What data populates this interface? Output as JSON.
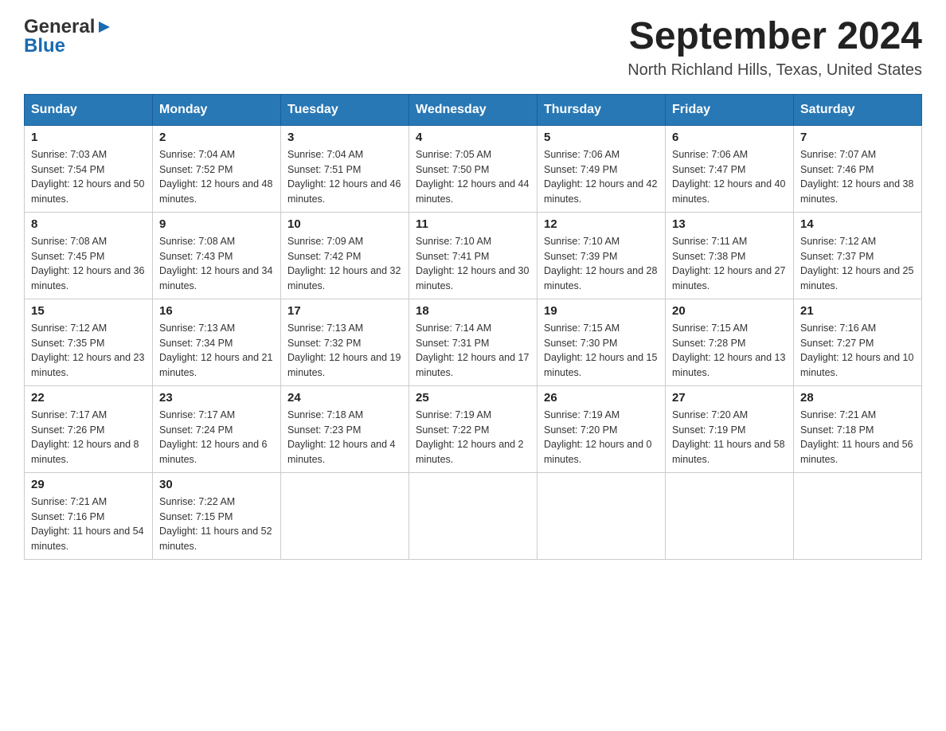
{
  "header": {
    "logo_general": "General",
    "logo_blue": "Blue",
    "month_title": "September 2024",
    "location": "North Richland Hills, Texas, United States"
  },
  "days_of_week": [
    "Sunday",
    "Monday",
    "Tuesday",
    "Wednesday",
    "Thursday",
    "Friday",
    "Saturday"
  ],
  "weeks": [
    [
      {
        "day": "1",
        "sunrise": "Sunrise: 7:03 AM",
        "sunset": "Sunset: 7:54 PM",
        "daylight": "Daylight: 12 hours and 50 minutes."
      },
      {
        "day": "2",
        "sunrise": "Sunrise: 7:04 AM",
        "sunset": "Sunset: 7:52 PM",
        "daylight": "Daylight: 12 hours and 48 minutes."
      },
      {
        "day": "3",
        "sunrise": "Sunrise: 7:04 AM",
        "sunset": "Sunset: 7:51 PM",
        "daylight": "Daylight: 12 hours and 46 minutes."
      },
      {
        "day": "4",
        "sunrise": "Sunrise: 7:05 AM",
        "sunset": "Sunset: 7:50 PM",
        "daylight": "Daylight: 12 hours and 44 minutes."
      },
      {
        "day": "5",
        "sunrise": "Sunrise: 7:06 AM",
        "sunset": "Sunset: 7:49 PM",
        "daylight": "Daylight: 12 hours and 42 minutes."
      },
      {
        "day": "6",
        "sunrise": "Sunrise: 7:06 AM",
        "sunset": "Sunset: 7:47 PM",
        "daylight": "Daylight: 12 hours and 40 minutes."
      },
      {
        "day": "7",
        "sunrise": "Sunrise: 7:07 AM",
        "sunset": "Sunset: 7:46 PM",
        "daylight": "Daylight: 12 hours and 38 minutes."
      }
    ],
    [
      {
        "day": "8",
        "sunrise": "Sunrise: 7:08 AM",
        "sunset": "Sunset: 7:45 PM",
        "daylight": "Daylight: 12 hours and 36 minutes."
      },
      {
        "day": "9",
        "sunrise": "Sunrise: 7:08 AM",
        "sunset": "Sunset: 7:43 PM",
        "daylight": "Daylight: 12 hours and 34 minutes."
      },
      {
        "day": "10",
        "sunrise": "Sunrise: 7:09 AM",
        "sunset": "Sunset: 7:42 PM",
        "daylight": "Daylight: 12 hours and 32 minutes."
      },
      {
        "day": "11",
        "sunrise": "Sunrise: 7:10 AM",
        "sunset": "Sunset: 7:41 PM",
        "daylight": "Daylight: 12 hours and 30 minutes."
      },
      {
        "day": "12",
        "sunrise": "Sunrise: 7:10 AM",
        "sunset": "Sunset: 7:39 PM",
        "daylight": "Daylight: 12 hours and 28 minutes."
      },
      {
        "day": "13",
        "sunrise": "Sunrise: 7:11 AM",
        "sunset": "Sunset: 7:38 PM",
        "daylight": "Daylight: 12 hours and 27 minutes."
      },
      {
        "day": "14",
        "sunrise": "Sunrise: 7:12 AM",
        "sunset": "Sunset: 7:37 PM",
        "daylight": "Daylight: 12 hours and 25 minutes."
      }
    ],
    [
      {
        "day": "15",
        "sunrise": "Sunrise: 7:12 AM",
        "sunset": "Sunset: 7:35 PM",
        "daylight": "Daylight: 12 hours and 23 minutes."
      },
      {
        "day": "16",
        "sunrise": "Sunrise: 7:13 AM",
        "sunset": "Sunset: 7:34 PM",
        "daylight": "Daylight: 12 hours and 21 minutes."
      },
      {
        "day": "17",
        "sunrise": "Sunrise: 7:13 AM",
        "sunset": "Sunset: 7:32 PM",
        "daylight": "Daylight: 12 hours and 19 minutes."
      },
      {
        "day": "18",
        "sunrise": "Sunrise: 7:14 AM",
        "sunset": "Sunset: 7:31 PM",
        "daylight": "Daylight: 12 hours and 17 minutes."
      },
      {
        "day": "19",
        "sunrise": "Sunrise: 7:15 AM",
        "sunset": "Sunset: 7:30 PM",
        "daylight": "Daylight: 12 hours and 15 minutes."
      },
      {
        "day": "20",
        "sunrise": "Sunrise: 7:15 AM",
        "sunset": "Sunset: 7:28 PM",
        "daylight": "Daylight: 12 hours and 13 minutes."
      },
      {
        "day": "21",
        "sunrise": "Sunrise: 7:16 AM",
        "sunset": "Sunset: 7:27 PM",
        "daylight": "Daylight: 12 hours and 10 minutes."
      }
    ],
    [
      {
        "day": "22",
        "sunrise": "Sunrise: 7:17 AM",
        "sunset": "Sunset: 7:26 PM",
        "daylight": "Daylight: 12 hours and 8 minutes."
      },
      {
        "day": "23",
        "sunrise": "Sunrise: 7:17 AM",
        "sunset": "Sunset: 7:24 PM",
        "daylight": "Daylight: 12 hours and 6 minutes."
      },
      {
        "day": "24",
        "sunrise": "Sunrise: 7:18 AM",
        "sunset": "Sunset: 7:23 PM",
        "daylight": "Daylight: 12 hours and 4 minutes."
      },
      {
        "day": "25",
        "sunrise": "Sunrise: 7:19 AM",
        "sunset": "Sunset: 7:22 PM",
        "daylight": "Daylight: 12 hours and 2 minutes."
      },
      {
        "day": "26",
        "sunrise": "Sunrise: 7:19 AM",
        "sunset": "Sunset: 7:20 PM",
        "daylight": "Daylight: 12 hours and 0 minutes."
      },
      {
        "day": "27",
        "sunrise": "Sunrise: 7:20 AM",
        "sunset": "Sunset: 7:19 PM",
        "daylight": "Daylight: 11 hours and 58 minutes."
      },
      {
        "day": "28",
        "sunrise": "Sunrise: 7:21 AM",
        "sunset": "Sunset: 7:18 PM",
        "daylight": "Daylight: 11 hours and 56 minutes."
      }
    ],
    [
      {
        "day": "29",
        "sunrise": "Sunrise: 7:21 AM",
        "sunset": "Sunset: 7:16 PM",
        "daylight": "Daylight: 11 hours and 54 minutes."
      },
      {
        "day": "30",
        "sunrise": "Sunrise: 7:22 AM",
        "sunset": "Sunset: 7:15 PM",
        "daylight": "Daylight: 11 hours and 52 minutes."
      },
      null,
      null,
      null,
      null,
      null
    ]
  ]
}
